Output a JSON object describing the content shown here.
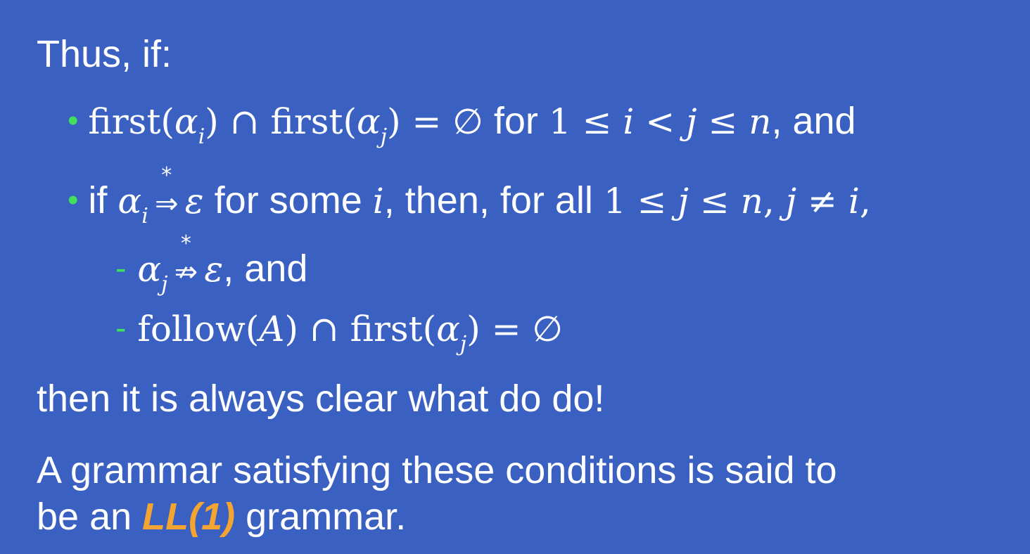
{
  "slide": {
    "intro": "Thus, if:",
    "bullet1": {
      "math": "first(α_i) ∩ first(α_j) = ∅",
      "text1": "for",
      "math2": "1 ≤ i < j ≤ n",
      "text2": ", and"
    },
    "bullet2": {
      "text1": "if",
      "math1": "α_i ⇒* ε",
      "text2": "for some",
      "math2": "i",
      "text3": ", then, for all",
      "math3": "1 ≤ j ≤ n, j ≠ i,"
    },
    "sub1": {
      "math": "α_j ⇏* ε",
      "text": ", and"
    },
    "sub2": {
      "math": "follow(A) ∩ first(α_j) = ∅"
    },
    "conclusion": "then it is always clear what do do!",
    "definition_line1": "A grammar satisfying these conditions is said to",
    "definition_line2_pre": "be an",
    "definition_highlight": "LL(1)",
    "definition_line2_post": "grammar."
  },
  "colors": {
    "background": "#3a60c2",
    "text": "#ffffff",
    "bullet": "#42e05a",
    "highlight": "#f4a531"
  }
}
